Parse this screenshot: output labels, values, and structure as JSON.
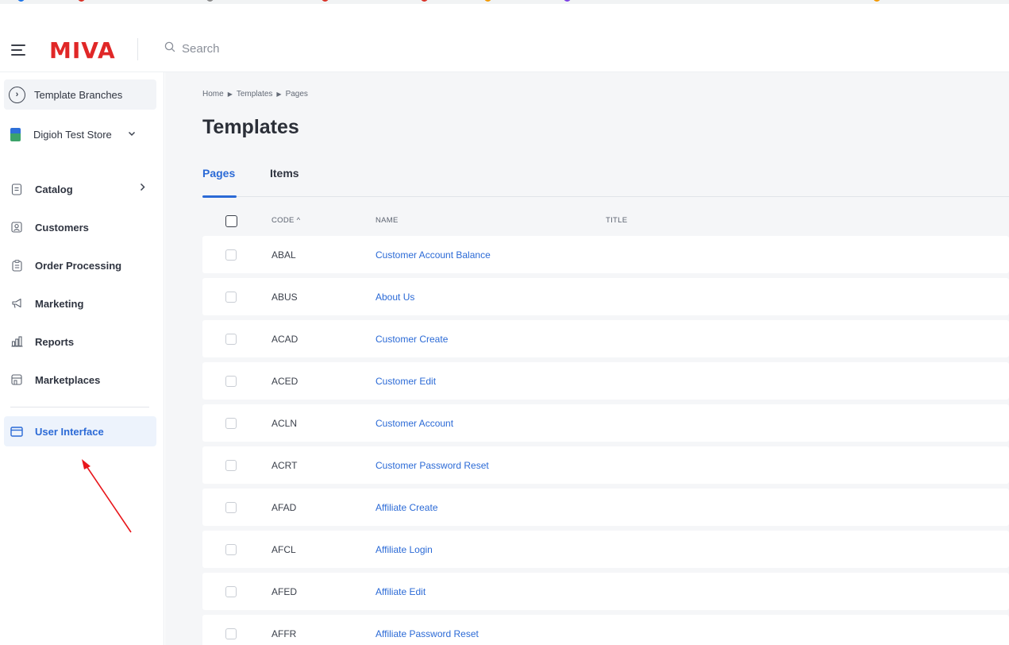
{
  "app": {
    "brand": "MIVA",
    "brand_color": "#e02727",
    "accent_color": "#2b6ad6"
  },
  "search": {
    "placeholder": "Search"
  },
  "sidebar": {
    "branches_label": "Template Branches",
    "store_label": "Digioh Test Store",
    "items": [
      {
        "label": "Catalog",
        "icon": "catalog-icon"
      },
      {
        "label": "Customers",
        "icon": "customers-icon"
      },
      {
        "label": "Order Processing",
        "icon": "clipboard-icon"
      },
      {
        "label": "Marketing",
        "icon": "megaphone-icon"
      },
      {
        "label": "Reports",
        "icon": "bar-chart-icon"
      },
      {
        "label": "Marketplaces",
        "icon": "storefront-icon"
      },
      {
        "label": "User Interface",
        "icon": "window-icon",
        "active": true
      }
    ]
  },
  "breadcrumb": [
    "Home",
    "Templates",
    "Pages"
  ],
  "page": {
    "title": "Templates"
  },
  "tabs": [
    {
      "label": "Pages",
      "active": true
    },
    {
      "label": "Items",
      "active": false
    }
  ],
  "table": {
    "columns": [
      "CODE ^",
      "NAME",
      "TITLE"
    ],
    "rows": [
      {
        "code": "ABAL",
        "name": "Customer Account Balance",
        "title": ""
      },
      {
        "code": "ABUS",
        "name": "About Us",
        "title": ""
      },
      {
        "code": "ACAD",
        "name": "Customer Create",
        "title": ""
      },
      {
        "code": "ACED",
        "name": "Customer Edit",
        "title": ""
      },
      {
        "code": "ACLN",
        "name": "Customer Account",
        "title": ""
      },
      {
        "code": "ACRT",
        "name": "Customer Password Reset",
        "title": ""
      },
      {
        "code": "AFAD",
        "name": "Affiliate Create",
        "title": ""
      },
      {
        "code": "AFCL",
        "name": "Affiliate Login",
        "title": ""
      },
      {
        "code": "AFED",
        "name": "Affiliate Edit",
        "title": ""
      },
      {
        "code": "AFFR",
        "name": "Affiliate Password Reset",
        "title": ""
      }
    ]
  }
}
